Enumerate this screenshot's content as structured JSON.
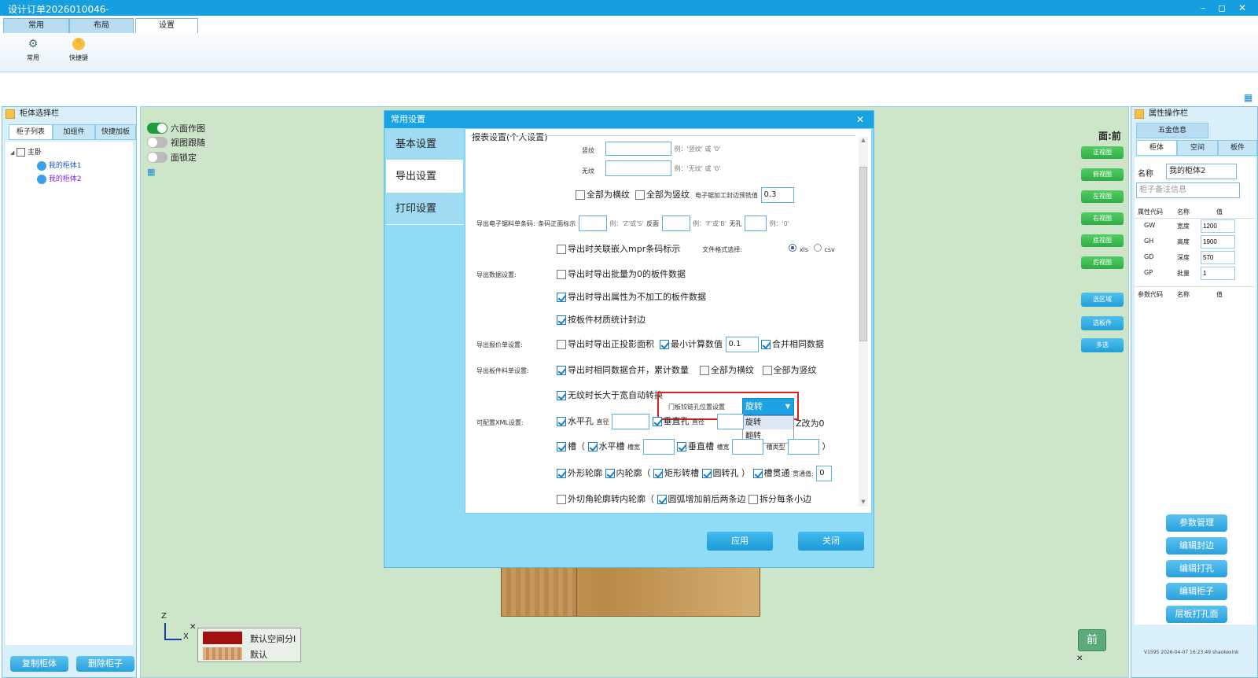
{
  "window": {
    "title": "设计订单2026010046-",
    "min": "–",
    "max": "◻",
    "close": "✕"
  },
  "tabs": [
    "常用",
    "布局",
    "设置"
  ],
  "ribbon": [
    {
      "label": "常用",
      "icon": "gear-icon"
    },
    {
      "label": "快捷键",
      "icon": "hand-icon"
    }
  ],
  "left_panel": {
    "title": "柜体选择栏",
    "tabs": [
      "柜子列表",
      "加组件",
      "快捷加板"
    ],
    "tree_root": "主卧",
    "tree_items": [
      "我的柜体1",
      "我的柜体2"
    ],
    "buttons": [
      "复制柜体",
      "删除柜子"
    ]
  },
  "scene": {
    "toggles": [
      {
        "label": "六面作图",
        "on": true
      },
      {
        "label": "视图跟随",
        "on": false
      },
      {
        "label": "面锁定",
        "on": false
      }
    ],
    "face_label": "面:前",
    "view_buttons": [
      "正视图",
      "俯视图",
      "左视图",
      "右视图",
      "底视图",
      "后视图"
    ],
    "select_buttons": [
      "选区域",
      "选板件",
      "多选"
    ],
    "axis_z": "Z",
    "axis_x": "X",
    "legend": [
      "默认空间分I",
      "默认"
    ],
    "cube_face": "前"
  },
  "right_panel": {
    "title": "属性操作栏",
    "hardware_tab": "五金信息",
    "tabs": [
      "柜体",
      "空间",
      "板件"
    ],
    "name_label": "名称",
    "name_value": "我的柜体2",
    "note_placeholder": "柜子备注信息",
    "attr_headers": [
      "属性代码",
      "名称",
      "值"
    ],
    "attrs": [
      {
        "code": "GW",
        "name": "宽度",
        "value": "1200"
      },
      {
        "code": "GH",
        "name": "高度",
        "value": "1900"
      },
      {
        "code": "GD",
        "name": "深度",
        "value": "570"
      },
      {
        "code": "GP",
        "name": "批量",
        "value": "1"
      }
    ],
    "param_headers": [
      "参数代码",
      "名称",
      "值"
    ],
    "buttons": [
      "参数管理",
      "编辑封边",
      "编辑打孔",
      "编辑柜子",
      "层板打孔面"
    ],
    "version": "V1595 2026-04-07 16:23:49 shaokexink"
  },
  "dialog": {
    "title": "常用设置",
    "close": "✕",
    "nav": [
      "基本设置",
      "导出设置",
      "打印设置"
    ],
    "section_title": "报表设置(个人设置)",
    "shuwen_label": "竖纹",
    "shuwen_hint": "例：'竖纹' 或 '0'",
    "wuwen_label": "无纹",
    "wuwen_hint": "例：'无纹' 或 '0'",
    "all_heng": "全部为横纹",
    "all_shu": "全部为竖纹",
    "edge_label": "电子锯加工封边预铣值",
    "edge_value": "0.3",
    "barcode_label": "导出电子锯料单条码:",
    "barcode_front": "条码正面标示",
    "barcode_front_hint": "例：'Z'或'S'",
    "barcode_back": "反面",
    "barcode_back_hint": "例：'F'或'B'",
    "barcode_none": "无孔",
    "barcode_none_hint": "例：'0'",
    "mpr_label": "导出时关联嵌入mpr条码标示",
    "file_format_label": "文件格式选择:",
    "fmt_xls": "xls",
    "fmt_csv": "csv",
    "data_label": "导出数据设置:",
    "data_opt1": "导出时导出批量为0的板件数据",
    "data_opt2": "导出时导出属性为不加工的板件数据",
    "data_opt3": "按板件材质统计封边",
    "quote_label": "导出报价单设置:",
    "quote_opt1": "导出时导出正投影面积",
    "quote_opt2": "最小计算数值",
    "quote_min": "0.1",
    "quote_opt3": "合并相同数据",
    "panel_label": "导出板件料单设置:",
    "panel_opt1": "导出时相同数据合并，累计数量",
    "panel_opt2": "全部为横纹",
    "panel_opt3": "全部为竖纹",
    "auto_rotate": "无纹时长大于宽自动转换",
    "hinge_label": "门板铰链孔位置设置",
    "hinge_value": "旋转",
    "hinge_options": [
      "旋转",
      "翻转"
    ],
    "xml_label": "可配置XML设置:",
    "xml_h_hole": "水平孔",
    "xml_dia": "直径",
    "xml_v_hole": "垂直孔",
    "xml_dia2": "直径",
    "xml_z0": "Z改为0",
    "groove": "槽（",
    "h_groove": "水平槽",
    "groove_w": "槽宽",
    "v_groove": "垂直槽",
    "groove_w2": "槽宽",
    "groove_type": "槽类型",
    "groove_close": "）",
    "outer": "外形轮廓",
    "inner": "内轮廓（",
    "rect_groove": "矩形转槽",
    "round_hole": "圆转孔 ）",
    "groove_through": "槽贯通",
    "through_val_label": "贯通值:",
    "through_val": "0",
    "cut_corner": "外切角轮廓转内轮廓（",
    "arc_add": "圆弧增加前后两条边",
    "split_edge": "拆分每条小边",
    "apply": "应用",
    "close_btn": "关闭"
  }
}
